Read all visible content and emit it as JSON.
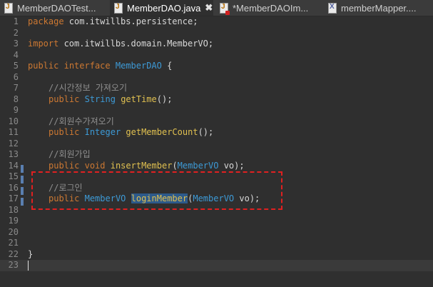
{
  "tabs": [
    {
      "label": "MemberDAOTest...",
      "icon": "java-file-icon",
      "active": false
    },
    {
      "label": "MemberDAO.java",
      "icon": "java-file-icon",
      "active": true,
      "close": "✖"
    },
    {
      "label": "*MemberDAOIm...",
      "icon": "java-file-error-icon",
      "active": false
    },
    {
      "label": "memberMapper....",
      "icon": "xml-file-icon",
      "active": false
    }
  ],
  "code": {
    "l1": {
      "kw": "package",
      "rest": " com.itwillbs.persistence;"
    },
    "l3": {
      "kw": "import",
      "rest": " com.itwillbs.domain.MemberVO;"
    },
    "l5": {
      "kw1": "public",
      "kw2": "interface",
      "name": "MemberDAO",
      "rest": " {"
    },
    "l7": {
      "cmt": "//시간정보 가져오기"
    },
    "l8": {
      "kw": "public",
      "type": "String",
      "fn": "getTime",
      "rest": "();"
    },
    "l10": {
      "cmt": "//회원수가져오기"
    },
    "l11": {
      "kw": "public",
      "type": "Integer",
      "fn": "getMemberCount",
      "rest": "();"
    },
    "l13": {
      "cmt": "//회원가입"
    },
    "l14": {
      "kw1": "public",
      "kw2": "void",
      "fn": "insertMember",
      "p1": "(",
      "ptype": "MemberVO",
      "pname": " vo",
      "rest": ");"
    },
    "l16": {
      "cmt": "//로그인"
    },
    "l17": {
      "kw": "public",
      "type": "MemberVO",
      "fn": "loginMember",
      "p1": "(",
      "ptype": "MemberVO",
      "pname": " vo",
      "rest": ");"
    },
    "l22": {
      "rest": "}"
    }
  },
  "line_numbers": [
    "1",
    "2",
    "3",
    "4",
    "5",
    "6",
    "7",
    "8",
    "9",
    "10",
    "11",
    "12",
    "13",
    "14",
    "15",
    "16",
    "17",
    "18",
    "19",
    "20",
    "21",
    "22",
    "23"
  ],
  "colors": {
    "keyword": "#cc7832",
    "type": "#3d9ad6",
    "method": "#e0c050",
    "comment": "#8f8f8f",
    "annotation_box": "#e02020"
  }
}
